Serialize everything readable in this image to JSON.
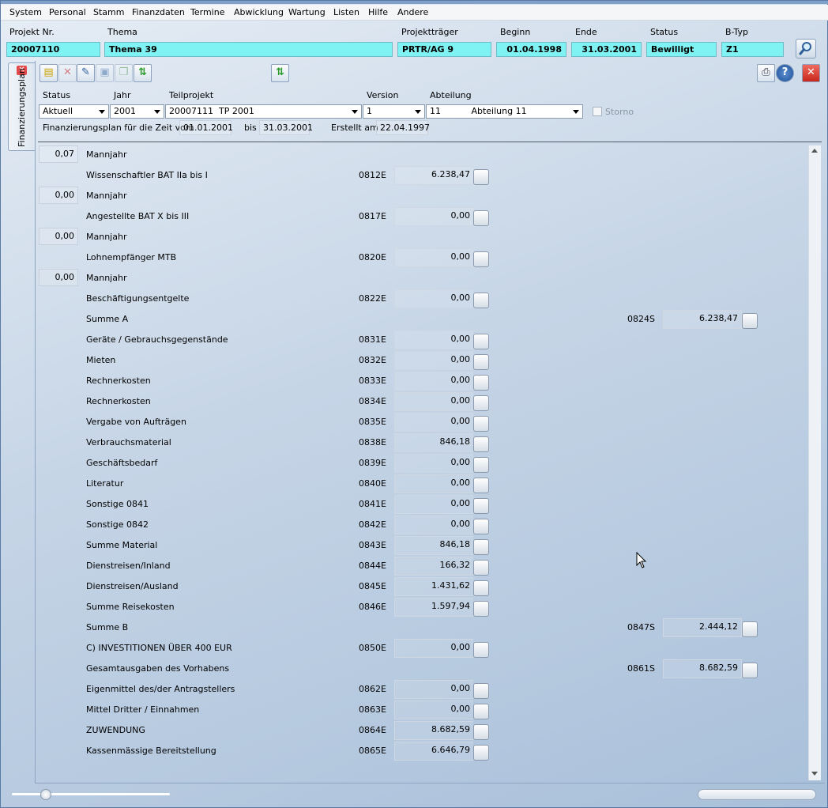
{
  "menu": [
    "System",
    "Personal",
    "Stamm",
    "Finanzdaten",
    "Termine",
    "Abwicklung",
    "Wartung",
    "Listen",
    "Hilfe",
    "Andere"
  ],
  "header": {
    "projekt_nr": {
      "label": "Projekt Nr.",
      "value": "20007110"
    },
    "thema": {
      "label": "Thema",
      "value": "Thema 39"
    },
    "projekttraeger": {
      "label": "Projektträger",
      "value": "PRTR/AG 9"
    },
    "beginn": {
      "label": "Beginn",
      "value": "01.04.1998"
    },
    "ende": {
      "label": "Ende",
      "value": "31.03.2001"
    },
    "status": {
      "label": "Status",
      "value": "Bewilligt"
    },
    "btyp": {
      "label": "B-Typ",
      "value": "Z1"
    }
  },
  "sidetab": {
    "label": "Finanzierungsplan"
  },
  "filters": {
    "status": {
      "label": "Status",
      "value": "Aktuell"
    },
    "jahr": {
      "label": "Jahr",
      "value": "2001"
    },
    "teilprojekt": {
      "label": "Teilprojekt",
      "value": "20007111  TP 2001"
    },
    "version": {
      "label": "Version",
      "value": "1"
    },
    "abteilung": {
      "label": "Abteilung",
      "value": "11           Abteilung 11"
    },
    "storno": "Storno"
  },
  "period": {
    "prefix": "Finanzierungsplan für die Zeit vom",
    "from": "01.01.2001",
    "bis": "bis",
    "to": "31.03.2001",
    "erstellt_label": "Erstellt am",
    "erstellt": "22.04.1997"
  },
  "rows": [
    {
      "type": "mj",
      "value": "0,07",
      "label": "Mannjahr"
    },
    {
      "type": "e",
      "label": "Wissenschaftler BAT IIa bis I",
      "code": "0812E",
      "value": "6.238,47"
    },
    {
      "type": "mj",
      "value": "0,00",
      "label": "Mannjahr"
    },
    {
      "type": "e",
      "label": "Angestellte BAT X bis III",
      "code": "0817E",
      "value": "0,00"
    },
    {
      "type": "mj",
      "value": "0,00",
      "label": "Mannjahr"
    },
    {
      "type": "e",
      "label": "Lohnempfänger MTB",
      "code": "0820E",
      "value": "0,00"
    },
    {
      "type": "mj",
      "value": "0,00",
      "label": "Mannjahr"
    },
    {
      "type": "e",
      "label": "Beschäftigungsentgelte",
      "code": "0822E",
      "value": "0,00"
    },
    {
      "type": "s",
      "label": "Summe A",
      "code": "0824S",
      "value": "6.238,47"
    },
    {
      "type": "e",
      "label": "Geräte / Gebrauchsgegenstände",
      "code": "0831E",
      "value": "0,00"
    },
    {
      "type": "e",
      "label": "Mieten",
      "code": "0832E",
      "value": "0,00"
    },
    {
      "type": "e",
      "label": "Rechnerkosten",
      "code": "0833E",
      "value": "0,00"
    },
    {
      "type": "e",
      "label": "Rechnerkosten",
      "code": "0834E",
      "value": "0,00"
    },
    {
      "type": "e",
      "label": "Vergabe von Aufträgen",
      "code": "0835E",
      "value": "0,00"
    },
    {
      "type": "e",
      "label": "Verbrauchsmaterial",
      "code": "0838E",
      "value": "846,18"
    },
    {
      "type": "e",
      "label": "Geschäftsbedarf",
      "code": "0839E",
      "value": "0,00"
    },
    {
      "type": "e",
      "label": "Literatur",
      "code": "0840E",
      "value": "0,00"
    },
    {
      "type": "e",
      "label": "Sonstige 0841",
      "code": "0841E",
      "value": "0,00"
    },
    {
      "type": "e",
      "label": "Sonstige 0842",
      "code": "0842E",
      "value": "0,00"
    },
    {
      "type": "e",
      "label": "Summe Material",
      "code": "0843E",
      "value": "846,18"
    },
    {
      "type": "e",
      "label": "Dienstreisen/Inland",
      "code": "0844E",
      "value": "166,32"
    },
    {
      "type": "e",
      "label": "Dienstreisen/Ausland",
      "code": "0845E",
      "value": "1.431,62"
    },
    {
      "type": "e",
      "label": "Summe Reisekosten",
      "code": "0846E",
      "value": "1.597,94"
    },
    {
      "type": "s",
      "label": "Summe B",
      "code": "0847S",
      "value": "2.444,12"
    },
    {
      "type": "e",
      "label": "C) INVESTITIONEN ÜBER 400 EUR",
      "code": "0850E",
      "value": "0,00"
    },
    {
      "type": "s",
      "label": "Gesamtausgaben des Vorhabens",
      "code": "0861S",
      "value": "8.682,59"
    },
    {
      "type": "e",
      "label": "Eigenmittel des/der Antragstellers",
      "code": "0862E",
      "value": "0,00"
    },
    {
      "type": "e",
      "label": "Mittel Dritter / Einnahmen",
      "code": "0863E",
      "value": "0,00"
    },
    {
      "type": "e",
      "label": "ZUWENDUNG",
      "code": "0864E",
      "value": "8.682,59"
    },
    {
      "type": "e",
      "label": "Kassenmässige Bereitstellung",
      "code": "0865E",
      "value": "6.646,79"
    }
  ]
}
